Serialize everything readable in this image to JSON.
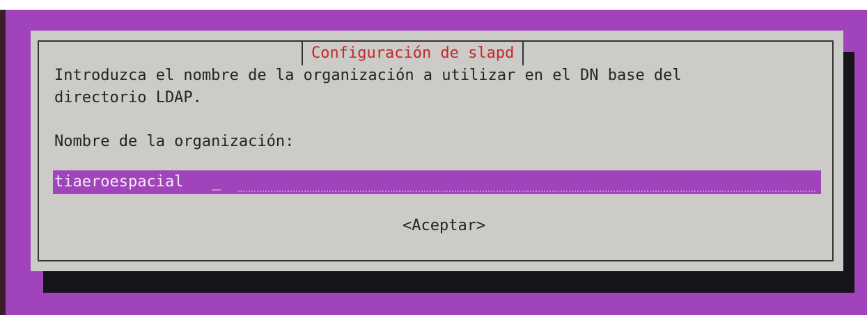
{
  "dialog": {
    "title": "Configuración de slapd",
    "message_line1": "Introduzca el nombre de la organización a utilizar en el DN base del",
    "message_line2": "directorio LDAP.",
    "field_label": "Nombre de la organización:",
    "input_value": "tiaeroespacial",
    "cursor": "_",
    "ok_label": "<Aceptar>"
  },
  "colors": {
    "terminal_background": "#a144bb",
    "dialog_background": "#cdcbc7",
    "title_text": "#c0292e",
    "input_background": "#a144bb",
    "shadow": "#17141c"
  }
}
